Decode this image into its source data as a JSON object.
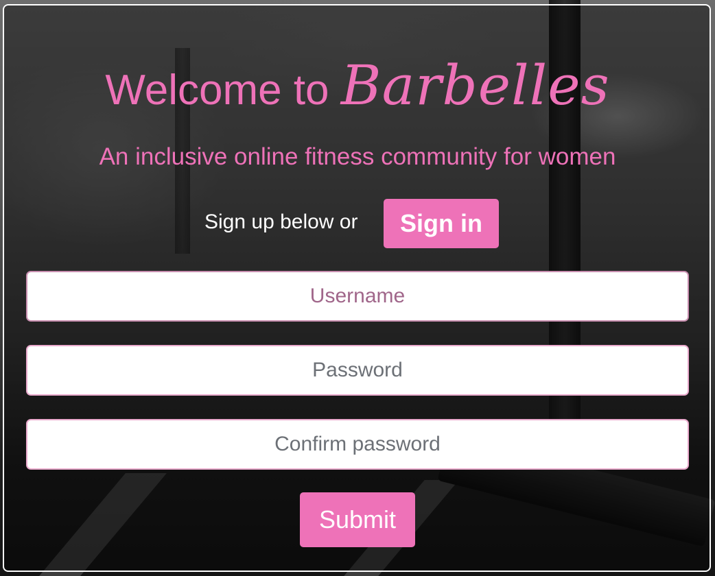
{
  "header": {
    "welcome": "Welcome to",
    "brand": "Barbelles",
    "tagline": "An inclusive online fitness community for women"
  },
  "auth": {
    "prompt": "Sign up below or",
    "signin_label": "Sign in"
  },
  "form": {
    "username_placeholder": "Username",
    "password_placeholder": "Password",
    "confirm_placeholder": "Confirm password",
    "submit_label": "Submit"
  },
  "colors": {
    "accent": "#ee72b8",
    "panel_border": "#ffffff",
    "field_border": "#e9a9cc"
  },
  "icons": []
}
